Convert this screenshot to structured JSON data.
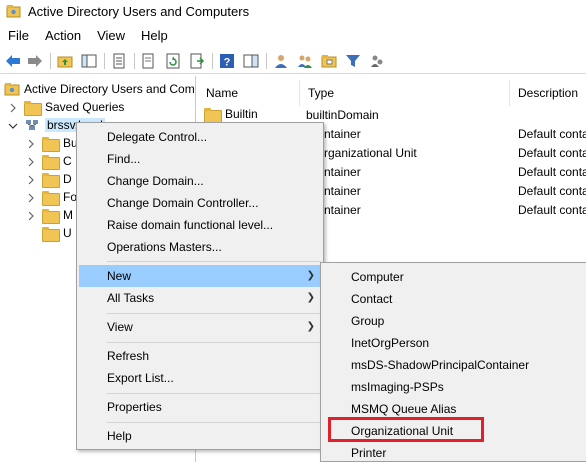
{
  "window": {
    "title": "Active Directory Users and Computers",
    "app_icon": "ad-users-computers-icon"
  },
  "menubar": {
    "items": [
      "File",
      "Action",
      "View",
      "Help"
    ]
  },
  "toolbar": {
    "icons": [
      "back-arrow-icon",
      "forward-arrow-icon",
      "up-folder-icon",
      "show-hide-console-tree-icon",
      "properties-sheet-icon",
      "export-list-icon",
      "refresh-icon",
      "help-icon",
      "action-pane-icon",
      "new-user-icon",
      "new-group-icon",
      "new-ou-icon",
      "filter-icon",
      "add-to-group-icon"
    ]
  },
  "tree": {
    "root": "Active Directory Users and Com",
    "saved_queries": "Saved Queries",
    "domain": "brssv.local",
    "children": [
      "Bu",
      "C",
      "D",
      "Fo",
      "M",
      "U"
    ]
  },
  "list": {
    "columns": [
      "Name",
      "Type",
      "Description"
    ],
    "rows": [
      {
        "name": "Builtin",
        "type": "builtinDomain",
        "description": ""
      },
      {
        "name": "",
        "type": "ntainer",
        "description": "Default conta"
      },
      {
        "name": "",
        "type": "rganizational Unit",
        "description": "Default conta"
      },
      {
        "name": "",
        "type": "ntainer",
        "description": "Default conta"
      },
      {
        "name": "",
        "type": "ntainer",
        "description": "Default conta"
      },
      {
        "name": "",
        "type": "ntainer",
        "description": "Default conta"
      }
    ]
  },
  "context_menu": {
    "items": [
      "Delegate Control...",
      "Find...",
      "Change Domain...",
      "Change Domain Controller...",
      "Raise domain functional level...",
      "Operations Masters...",
      "New",
      "All Tasks",
      "View",
      "Refresh",
      "Export List...",
      "Properties",
      "Help"
    ],
    "highlighted": "New"
  },
  "submenu": {
    "items": [
      "Computer",
      "Contact",
      "Group",
      "InetOrgPerson",
      "msDS-ShadowPrincipalContainer",
      "msImaging-PSPs",
      "MSMQ Queue Alias",
      "Organizational Unit",
      "Printer"
    ],
    "callout_item": "Organizational Unit"
  },
  "colors": {
    "highlight": "#99ccff",
    "callout": "#e0202a",
    "menu_bg": "#f0f0f0"
  }
}
